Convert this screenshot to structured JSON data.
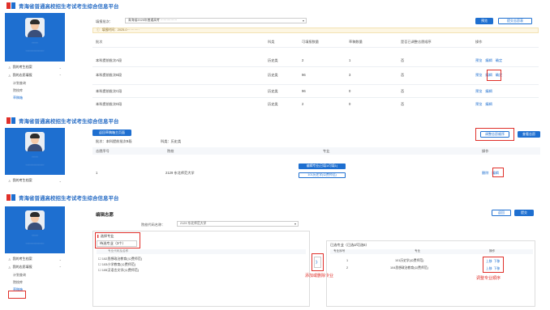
{
  "header_title": "青海省普通高校招生考试考生综合信息平台",
  "sidebar": {
    "user_line1": "······",
    "user_line2": "·················",
    "menu_item1": "我的考生档案",
    "menu_item2": "我的志愿填报",
    "sub_items": [
      "计划查询",
      "院校库",
      "草稿箱"
    ]
  },
  "panel1": {
    "filter_label": "填报批次：",
    "filter_value": "青海省2025年普通高考 ················",
    "btn_query": "预览",
    "btn_submit": "提交志愿表",
    "notice": "填报时间：2025-0············",
    "headers": [
      "批次",
      "科类",
      "可填报数量",
      "草稿数量",
      "是否已调整志愿顺序",
      "操作"
    ],
    "rows": [
      {
        "batch": "本科提前批次A段",
        "type": "历史类",
        "max": "2",
        "draft": "1",
        "adjusted": "否",
        "actions": [
          "预览",
          "编辑",
          "确定"
        ]
      },
      {
        "batch": "本科提前批次B段",
        "type": "历史类",
        "max": "96",
        "draft": "3",
        "adjusted": "否",
        "actions": [
          "预览",
          "编辑",
          "确定"
        ]
      },
      {
        "batch": "本科提前批次C段",
        "type": "历史类",
        "max": "96",
        "draft": "0",
        "adjusted": "否",
        "actions": [
          "预览",
          "编辑"
        ]
      },
      {
        "batch": "本科提前批次D段",
        "type": "历史类",
        "max": "2",
        "draft": "0",
        "adjusted": "否",
        "actions": [
          "预览",
          "编辑"
        ]
      }
    ]
  },
  "panel2": {
    "back_btn": "返回草稿箱主页面",
    "info_batch": "批次：本科提前批次B段",
    "info_type": "科类：历史类",
    "btn_adjust": "调整志愿顺序",
    "btn_save": "查看志愿",
    "headers": [
      "志愿序号",
      "院校",
      "专业",
      "操作"
    ],
    "row": {
      "seq": "1",
      "school": "2129 东北师范大学",
      "majors": [
        "编辑专业(已填1/可填1)",
        "101历史学(公费师范)"
      ],
      "actions": [
        "删除",
        "编辑"
      ]
    }
  },
  "panel3": {
    "title": "编辑志愿",
    "btn_back": "返回",
    "btn_submit": "提交",
    "school_label": "院校代码名称：",
    "school_value": "2129 东北师范大学",
    "left_section": "选择专业",
    "left_tab": "待选专业（3个）",
    "left_header": "专业代码及名称",
    "left_items": [
      "102思想政治教育(公费师范)",
      "103小学教育(公费师范)",
      "105汉语言文学(公费师范)"
    ],
    "right_title": "已选专业（已选2/可选5）",
    "right_headers": [
      "专业序号",
      "专业",
      "操作"
    ],
    "right_rows": [
      {
        "seq": "1",
        "major": "101历史学(公费师范)",
        "actions": [
          "上移",
          "下移"
        ]
      },
      {
        "seq": "2",
        "major": "104思想政治教育(公费师范)",
        "actions": [
          "上移",
          "下移"
        ]
      }
    ],
    "add_arrow": "》",
    "note_add": "添加或删除专业",
    "note_order": "调整专业顺序"
  }
}
